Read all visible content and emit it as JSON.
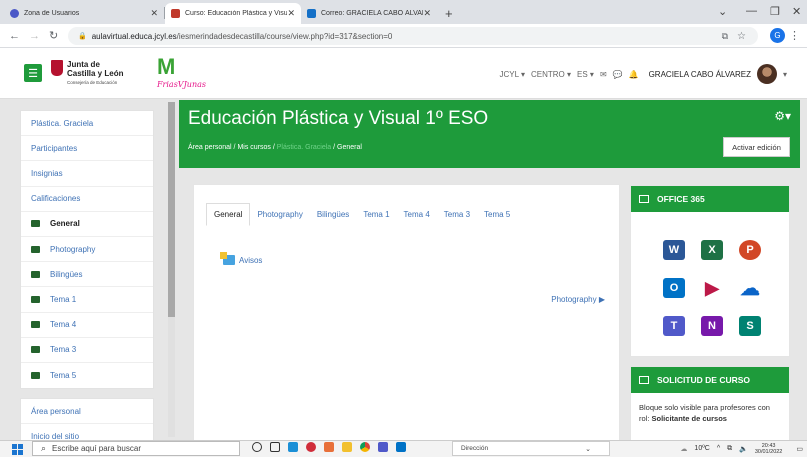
{
  "browser": {
    "tabs": [
      {
        "label": "Zona de Usuarios",
        "color": "#4b58c7"
      },
      {
        "label": "Curso: Educación Plástica y Visua",
        "color": "#c0392b"
      },
      {
        "label": "Correo: GRACIELA CABO ÁLVARE",
        "color": "#1470c7"
      }
    ],
    "url_host": "aulavirtual.educa.jcyl.es",
    "url_path": "/iesmerindadesdecastilla/course/view.php?id=317&section=0",
    "profile_initial": "G"
  },
  "site": {
    "jcyl_line1": "Junta de",
    "jcyl_line2": "Castilla y León",
    "jcyl_sub": "Consejería de Educación",
    "school_sub": "FriasVJunas",
    "nav": [
      "JCYL ▾",
      "CENTRO ▾",
      "ES ▾"
    ],
    "user": "GRACIELA CABO ÁLVAREZ"
  },
  "sidebar": {
    "items": [
      {
        "label": "Plástica. Graciela"
      },
      {
        "label": "Participantes"
      },
      {
        "label": "Insignias"
      },
      {
        "label": "Calificaciones"
      },
      {
        "label": "General",
        "folder": true,
        "current": true
      },
      {
        "label": "Photography",
        "folder": true
      },
      {
        "label": "Bilingües",
        "folder": true
      },
      {
        "label": "Tema 1",
        "folder": true
      },
      {
        "label": "Tema 4",
        "folder": true
      },
      {
        "label": "Tema 3",
        "folder": true
      },
      {
        "label": "Tema 5",
        "folder": true
      }
    ],
    "items2": [
      {
        "label": "Área personal"
      },
      {
        "label": "Inicio del sitio"
      }
    ]
  },
  "header": {
    "title": "Educación Plástica y Visual 1º ESO",
    "crumb1": "Área personal",
    "crumb2": "Mis cursos",
    "crumb3": "Plástica. Graciela",
    "crumb4": "General",
    "edit_button": "Activar edición"
  },
  "content": {
    "tabs": [
      "General",
      "Photography",
      "Bilingües",
      "Tema 1",
      "Tema 4",
      "Tema 3",
      "Tema 5"
    ],
    "avisos": "Avisos",
    "next_section": "Photography ▶"
  },
  "office": {
    "title": "OFFICE 365",
    "apps": [
      {
        "name": "word",
        "letter": "W",
        "color": "#2b5797"
      },
      {
        "name": "excel",
        "letter": "X",
        "color": "#1e7145"
      },
      {
        "name": "powerpoint",
        "letter": "P",
        "color": "#d24726"
      },
      {
        "name": "outlook",
        "letter": "O",
        "color": "#0072c6"
      },
      {
        "name": "stream",
        "letter": "▶",
        "color": "#bc1948"
      },
      {
        "name": "onedrive",
        "letter": "☁",
        "color": "#0a64c8"
      },
      {
        "name": "teams",
        "letter": "T",
        "color": "#5059c9"
      },
      {
        "name": "onenote",
        "letter": "N",
        "color": "#7719aa"
      },
      {
        "name": "sway",
        "letter": "S",
        "color": "#008272"
      }
    ]
  },
  "solicitud": {
    "title": "SOLICITUD DE CURSO",
    "text": "Bloque solo visible para profesores con rol",
    "bold": "Solicitante de cursos"
  },
  "taskbar": {
    "search": "Escribe aquí para buscar",
    "direccion": "Dirección",
    "weather": "10ºC",
    "time": "20:43",
    "date": "30/01/2022"
  },
  "colors": {
    "accent": "#1e9b3b",
    "link": "#3f72b5"
  }
}
